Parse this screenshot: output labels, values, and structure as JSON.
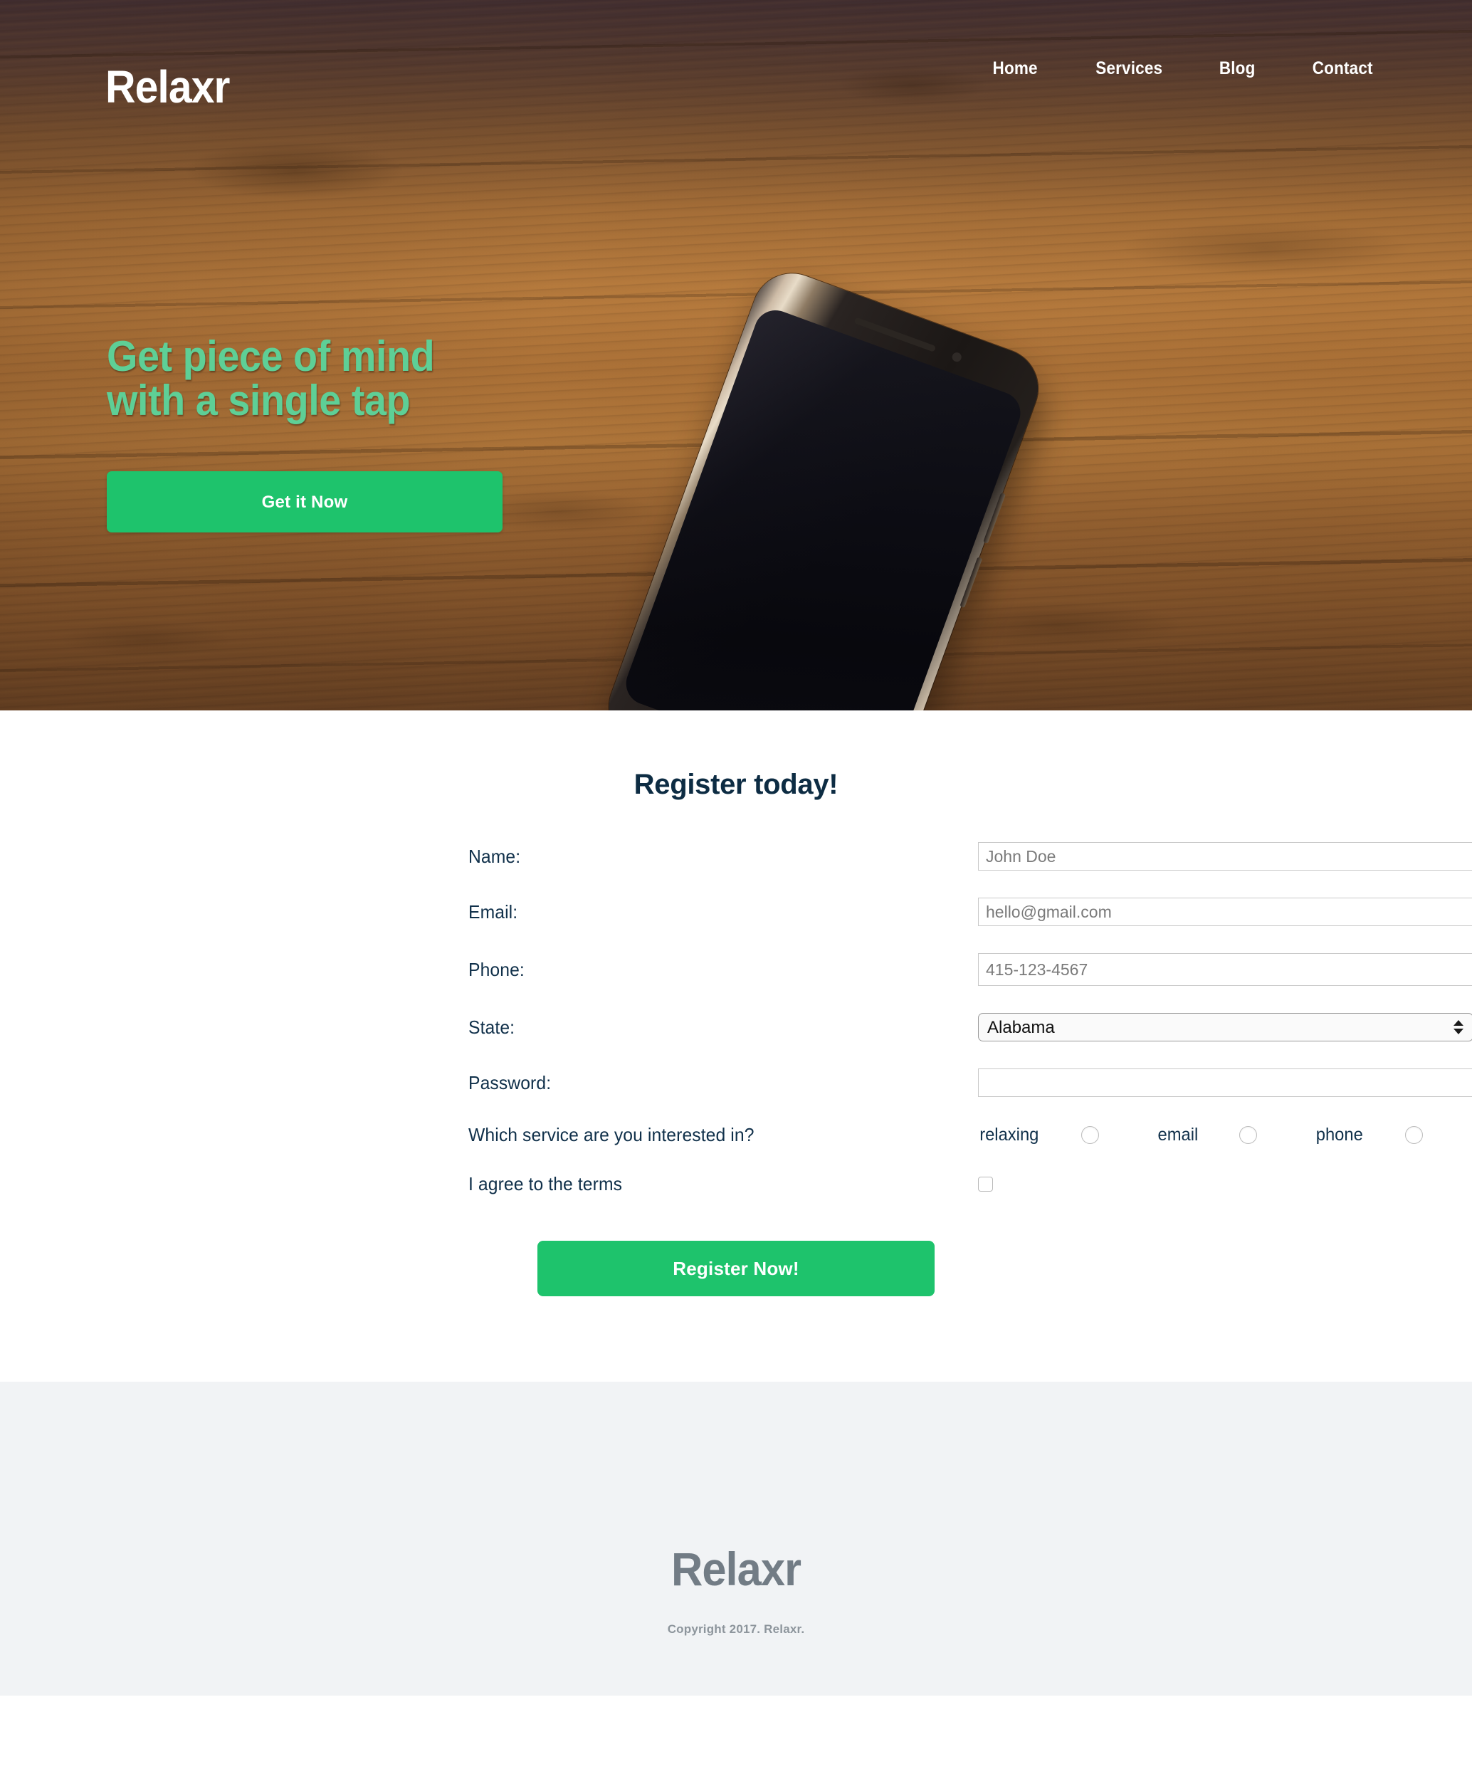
{
  "brand": "Relaxr",
  "nav": {
    "items": [
      {
        "label": "Home"
      },
      {
        "label": "Services"
      },
      {
        "label": "Blog"
      },
      {
        "label": "Contact"
      }
    ]
  },
  "hero": {
    "headline_line1": "Get piece of mind",
    "headline_line2": "with a single tap",
    "cta_label": "Get it Now",
    "headline_color": "#5ecf96",
    "cta_color": "#1ec36c"
  },
  "register": {
    "title": "Register today!",
    "fields": {
      "name": {
        "label": "Name:",
        "value": "",
        "placeholder": "John Doe"
      },
      "email": {
        "label": "Email:",
        "value": "",
        "placeholder": "hello@gmail.com"
      },
      "phone": {
        "label": "Phone:",
        "value": "",
        "placeholder": "415-123-4567"
      },
      "state": {
        "label": "State:",
        "selected": "Alabama"
      },
      "password": {
        "label": "Password:",
        "value": "",
        "placeholder": ""
      }
    },
    "service": {
      "label": "Which service are you interested in?",
      "options": [
        {
          "label": "relaxing"
        },
        {
          "label": "email"
        },
        {
          "label": "phone"
        }
      ]
    },
    "terms": {
      "label": "I agree to the terms",
      "checked": false
    },
    "submit_label": "Register Now!"
  },
  "footer": {
    "logo": "Relaxr",
    "copyright": "Copyright 2017. Relaxr.",
    "background": "#f1f3f5"
  }
}
